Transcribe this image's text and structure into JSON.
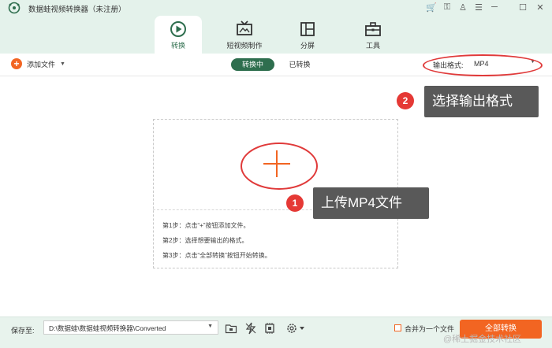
{
  "app": {
    "title": "数据蛙视频转换器（未注册）"
  },
  "window_controls": [
    {
      "icon": "cart-icon",
      "glyph": "🛒"
    },
    {
      "icon": "key-icon",
      "glyph": "⚿"
    },
    {
      "icon": "user-icon",
      "glyph": "♙"
    },
    {
      "icon": "menu-icon",
      "glyph": "☰"
    },
    {
      "icon": "minimize-icon",
      "glyph": "─"
    },
    {
      "icon": "maximize-icon",
      "glyph": "☐"
    },
    {
      "icon": "close-icon",
      "glyph": "✕"
    }
  ],
  "tabs": [
    {
      "label": "转换",
      "icon": "convert-icon",
      "active": true
    },
    {
      "label": "短视频制作",
      "icon": "tv-icon",
      "active": false
    },
    {
      "label": "分屏",
      "icon": "split-screen-icon",
      "active": false
    },
    {
      "label": "工具",
      "icon": "toolbox-icon",
      "active": false
    }
  ],
  "toolbar": {
    "add_file_label": "添加文件",
    "segments": {
      "converting": "转换中",
      "converted": "已转换"
    },
    "output_format_label": "输出格式:",
    "output_format_value": "MP4"
  },
  "drop_zone": {
    "steps": [
      "第1步：点击“+”按钮添加文件。",
      "第2步：选择想要输出的格式。",
      "第3步：点击“全部转换”按钮开始转换。"
    ]
  },
  "callouts": [
    {
      "number": "1",
      "text": "上传MP4文件"
    },
    {
      "number": "2",
      "text": "选择输出格式"
    }
  ],
  "bottom_bar": {
    "save_label": "保存至:",
    "save_path": "D:\\数据蛙\\数据蛙视频转换器\\Converted",
    "merge_label": "合并为一个文件",
    "convert_all_label": "全部转换"
  },
  "watermark": "@稀土掘金技术社区",
  "colors": {
    "accent_green": "#2e6e4e",
    "accent_orange": "#f26522",
    "annotation_red": "#e53935",
    "callout_bg": "#595959"
  }
}
